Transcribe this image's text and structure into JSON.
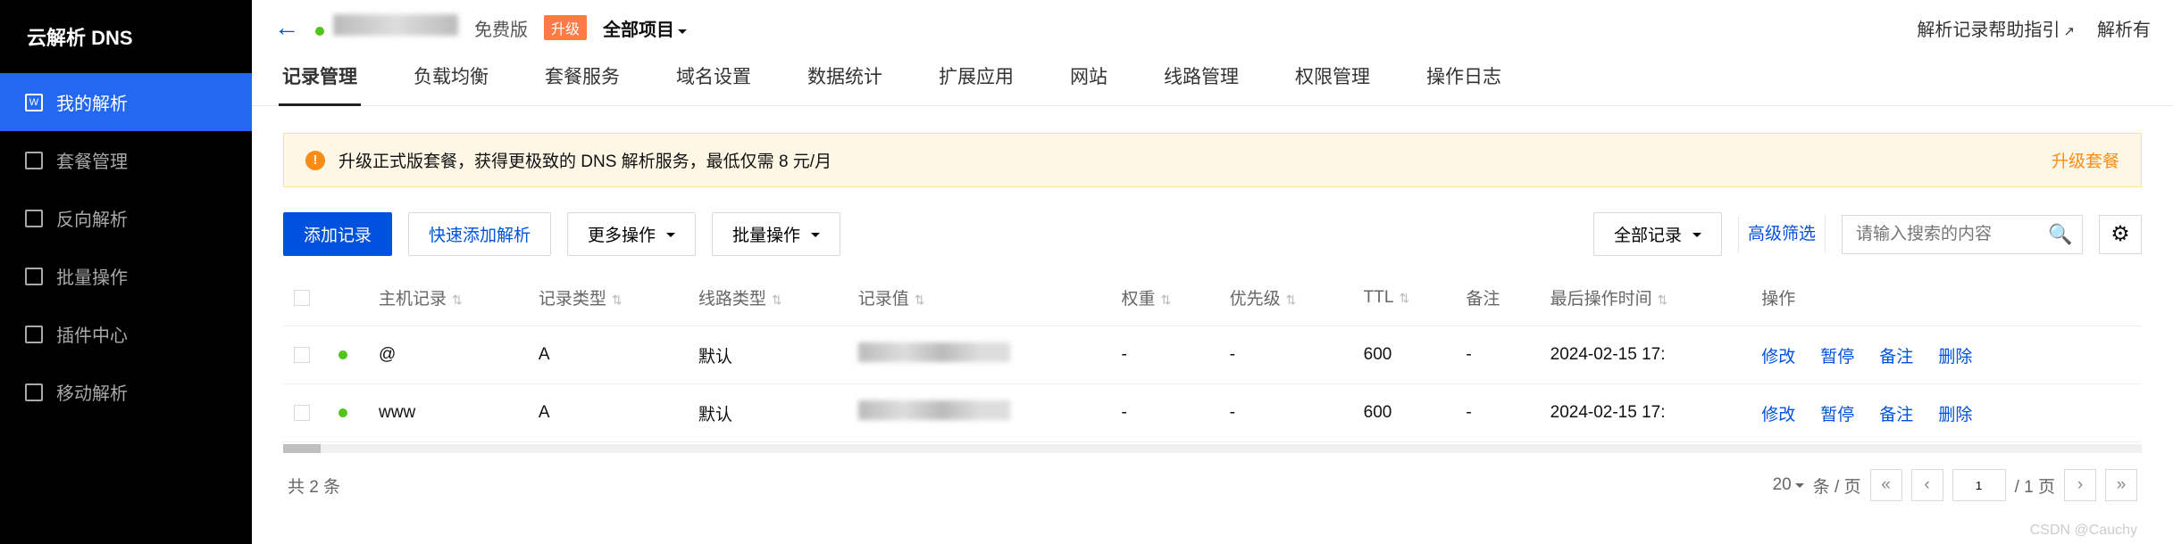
{
  "sidebar": {
    "title": "云解析 DNS",
    "items": [
      {
        "label": "我的解析",
        "icon": "w"
      },
      {
        "label": "套餐管理",
        "icon": "box"
      },
      {
        "label": "反向解析",
        "icon": "rev"
      },
      {
        "label": "批量操作",
        "icon": "batch"
      },
      {
        "label": "插件中心",
        "icon": "plug"
      },
      {
        "label": "移动解析",
        "icon": "mobile"
      }
    ]
  },
  "header": {
    "edition": "免费版",
    "upgrade": "升级",
    "project_selector": "全部项目",
    "help_link": "解析记录帮助指引",
    "right2": "解析有"
  },
  "tabs": [
    "记录管理",
    "负载均衡",
    "套餐服务",
    "域名设置",
    "数据统计",
    "扩展应用",
    "网站",
    "线路管理",
    "权限管理",
    "操作日志"
  ],
  "alert": {
    "text": "升级正式版套餐，获得更极致的 DNS 解析服务，最低仅需 8 元/月",
    "action": "升级套餐"
  },
  "toolbar": {
    "add": "添加记录",
    "quick": "快速添加解析",
    "more": "更多操作",
    "batch": "批量操作",
    "all_records": "全部记录",
    "adv_filter": "高级筛选",
    "search_placeholder": "请输入搜索的内容"
  },
  "columns": {
    "host": "主机记录",
    "type": "记录类型",
    "line": "线路类型",
    "value": "记录值",
    "weight": "权重",
    "priority": "优先级",
    "ttl": "TTL",
    "remark": "备注",
    "mtime": "最后操作时间",
    "ops": "操作"
  },
  "rows": [
    {
      "host": "@",
      "type": "A",
      "line": "默认",
      "weight": "-",
      "priority": "-",
      "ttl": "600",
      "remark": "-",
      "mtime": "2024-02-15 17:"
    },
    {
      "host": "www",
      "type": "A",
      "line": "默认",
      "weight": "-",
      "priority": "-",
      "ttl": "600",
      "remark": "-",
      "mtime": "2024-02-15 17:"
    }
  ],
  "ops": {
    "edit": "修改",
    "pause": "暂停",
    "remark": "备注",
    "delete": "删除"
  },
  "footer": {
    "total": "共 2 条",
    "page_size": "20",
    "per_page_suffix": "条 / 页",
    "page_no": "1",
    "page_total": "/ 1 页"
  },
  "watermark": "CSDN @Cauchy"
}
